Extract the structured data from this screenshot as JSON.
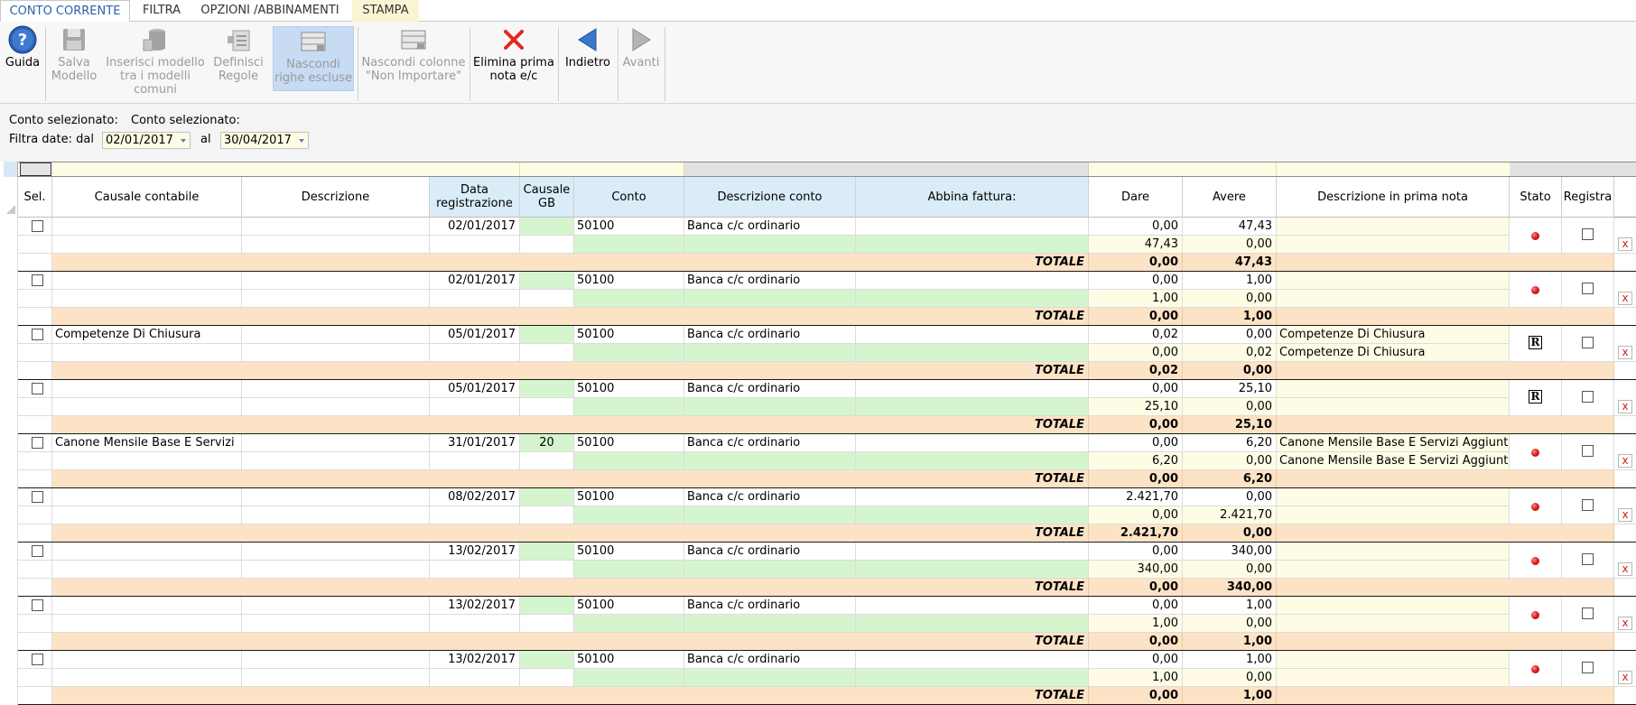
{
  "tabs": [
    {
      "label": "CONTO CORRENTE",
      "active": true
    },
    {
      "label": "FILTRA",
      "active": false
    },
    {
      "label": "OPZIONI /ABBINAMENTI",
      "active": false
    },
    {
      "label": "STAMPA",
      "active": false
    }
  ],
  "ribbon": {
    "guida": {
      "label": "Guida",
      "icon": "help-icon"
    },
    "salva": {
      "line1": "Salva",
      "line2": "Modello",
      "icon": "floppy-disk-icon",
      "enabled": false
    },
    "inserisci": {
      "line1": "Inserisci modello",
      "line2": "tra i modelli comuni",
      "icon": "database-insert-icon",
      "enabled": false
    },
    "definisci": {
      "line1": "Definisci",
      "line2": "Regole",
      "icon": "rules-icon",
      "enabled": false
    },
    "nascondi_righe": {
      "line1": "Nascondi",
      "line2": "righe escluse",
      "icon": "hide-rows-icon",
      "pressed": true
    },
    "nascondi_colonne": {
      "line1": "Nascondi colonne",
      "line2": "\"Non Importare\"",
      "icon": "hide-columns-icon",
      "enabled": false
    },
    "elimina": {
      "line1": "Elimina prima",
      "line2": "nota e/c",
      "icon": "red-x-icon"
    },
    "indietro": {
      "label": "Indietro",
      "icon": "arrow-left-icon"
    },
    "avanti": {
      "label": "Avanti",
      "icon": "arrow-right-icon",
      "enabled": false
    }
  },
  "filters": {
    "conto_label_1": "Conto selezionato:",
    "conto_label_2": "Conto selezionato:",
    "filtra_label": "Filtra date: dal",
    "date_from": "02/01/2017",
    "al_label": "al",
    "date_to": "30/04/2017"
  },
  "columns": {
    "sel": "Sel.",
    "causale": "Causale contabile",
    "descrizione": "Descrizione",
    "data_line1": "Data",
    "data_line2": "registrazione",
    "causale_gb_line1": "Causale",
    "causale_gb_line2": "GB",
    "conto": "Conto",
    "descr_conto": "Descrizione conto",
    "abbina": "Abbina fattura:",
    "dare": "Dare",
    "avere": "Avere",
    "descr_prima_nota": "Descrizione in prima nota",
    "stato": "Stato",
    "registra": "Registra"
  },
  "totale_label": "TOTALE",
  "colors": {
    "yellow": "#fffce6",
    "green": "#d5f5cf",
    "blue_header": "#daecf8",
    "totale": "#fde3c6",
    "accent": "#2a62a8"
  },
  "groups": [
    {
      "causale": "",
      "data": "02/01/2017",
      "gb": "",
      "conto": "50100",
      "descr_conto": "Banca c/c ordinario",
      "r1_dare": "0,00",
      "r1_avere": "47,43",
      "r2_dare": "47,43",
      "r2_avere": "0,00",
      "pn1": "",
      "pn2": "",
      "tot_dare": "0,00",
      "tot_avere": "47,43",
      "stato": "red-dot"
    },
    {
      "causale": "",
      "data": "02/01/2017",
      "gb": "",
      "conto": "50100",
      "descr_conto": "Banca c/c ordinario",
      "r1_dare": "0,00",
      "r1_avere": "1,00",
      "r2_dare": "1,00",
      "r2_avere": "0,00",
      "pn1": "",
      "pn2": "",
      "tot_dare": "0,00",
      "tot_avere": "1,00",
      "stato": "red-dot"
    },
    {
      "causale": "Competenze Di Chiusura",
      "data": "05/01/2017",
      "gb": "",
      "conto": "50100",
      "descr_conto": "Banca c/c ordinario",
      "r1_dare": "0,02",
      "r1_avere": "0,00",
      "r2_dare": "0,00",
      "r2_avere": "0,02",
      "pn1": "Competenze Di Chiusura",
      "pn2": "Competenze Di Chiusura",
      "tot_dare": "0,02",
      "tot_avere": "0,00",
      "stato": "R"
    },
    {
      "causale": "",
      "data": "05/01/2017",
      "gb": "",
      "conto": "50100",
      "descr_conto": "Banca c/c ordinario",
      "r1_dare": "0,00",
      "r1_avere": "25,10",
      "r2_dare": "25,10",
      "r2_avere": "0,00",
      "pn1": "",
      "pn2": "",
      "tot_dare": "0,00",
      "tot_avere": "25,10",
      "stato": "R"
    },
    {
      "causale": "Canone Mensile Base E Servizi",
      "data": "31/01/2017",
      "gb": "20",
      "conto": "50100",
      "descr_conto": "Banca c/c ordinario",
      "r1_dare": "0,00",
      "r1_avere": "6,20",
      "r2_dare": "6,20",
      "r2_avere": "0,00",
      "pn1": "Canone Mensile Base E Servizi Aggiuntiv",
      "pn2": "Canone Mensile Base E Servizi Aggiuntiv",
      "tot_dare": "0,00",
      "tot_avere": "6,20",
      "stato": "red-dot"
    },
    {
      "causale": "",
      "data": "08/02/2017",
      "gb": "",
      "conto": "50100",
      "descr_conto": "Banca c/c ordinario",
      "r1_dare": "2.421,70",
      "r1_avere": "0,00",
      "r2_dare": "0,00",
      "r2_avere": "2.421,70",
      "pn1": "",
      "pn2": "",
      "tot_dare": "2.421,70",
      "tot_avere": "0,00",
      "stato": "red-dot"
    },
    {
      "causale": "",
      "data": "13/02/2017",
      "gb": "",
      "conto": "50100",
      "descr_conto": "Banca c/c ordinario",
      "r1_dare": "0,00",
      "r1_avere": "340,00",
      "r2_dare": "340,00",
      "r2_avere": "0,00",
      "pn1": "",
      "pn2": "",
      "tot_dare": "0,00",
      "tot_avere": "340,00",
      "stato": "red-dot"
    },
    {
      "causale": "",
      "data": "13/02/2017",
      "gb": "",
      "conto": "50100",
      "descr_conto": "Banca c/c ordinario",
      "r1_dare": "0,00",
      "r1_avere": "1,00",
      "r2_dare": "1,00",
      "r2_avere": "0,00",
      "pn1": "",
      "pn2": "",
      "tot_dare": "0,00",
      "tot_avere": "1,00",
      "stato": "red-dot"
    },
    {
      "causale": "",
      "data": "13/02/2017",
      "gb": "",
      "conto": "50100",
      "descr_conto": "Banca c/c ordinario",
      "r1_dare": "0,00",
      "r1_avere": "1,00",
      "r2_dare": "1,00",
      "r2_avere": "0,00",
      "pn1": "",
      "pn2": "",
      "tot_dare": "0,00",
      "tot_avere": "1,00",
      "stato": "red-dot"
    }
  ]
}
